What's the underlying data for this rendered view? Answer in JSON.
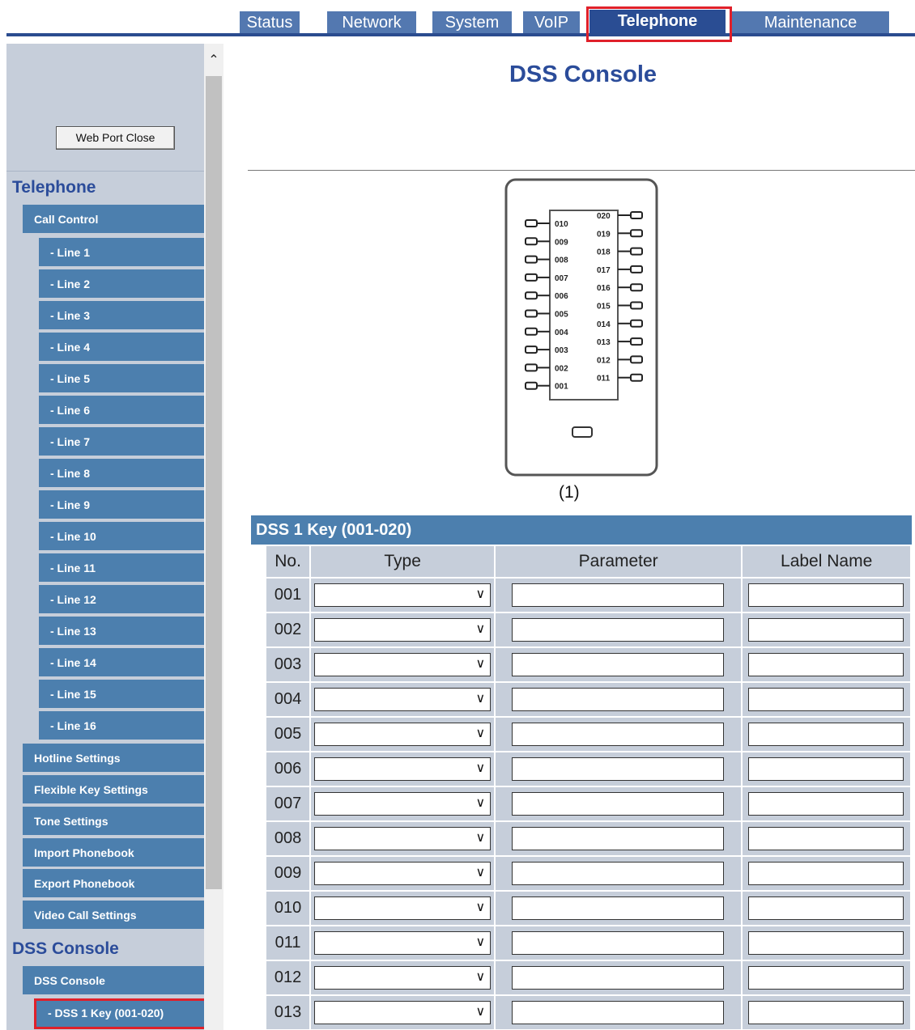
{
  "tabs": [
    {
      "label": "Status"
    },
    {
      "label": "Network"
    },
    {
      "label": "System"
    },
    {
      "label": "VoIP"
    },
    {
      "label": "Telephone"
    },
    {
      "label": "Maintenance"
    }
  ],
  "sidebar": {
    "web_port_button": "Web Port Close",
    "telephone_title": "Telephone",
    "call_control": "Call Control",
    "lines": [
      "- Line 1",
      "- Line 2",
      "- Line 3",
      "- Line 4",
      "- Line 5",
      "- Line 6",
      "- Line 7",
      "- Line 8",
      "- Line 9",
      "- Line 10",
      "- Line 11",
      "- Line 12",
      "- Line 13",
      "- Line 14",
      "- Line 15",
      "- Line 16"
    ],
    "items": [
      "Hotline Settings",
      "Flexible Key Settings",
      "Tone Settings",
      "Import Phonebook",
      "Export Phonebook",
      "Video Call Settings"
    ],
    "dss_title": "DSS Console",
    "dss_console": "DSS Console",
    "dss_key": "- DSS 1 Key (001-020)"
  },
  "main": {
    "title": "DSS Console",
    "console_caption": "(1)",
    "console_left_keys": [
      "010",
      "009",
      "008",
      "007",
      "006",
      "005",
      "004",
      "003",
      "002",
      "001"
    ],
    "console_right_keys": [
      "020",
      "019",
      "018",
      "017",
      "016",
      "015",
      "014",
      "013",
      "012",
      "011"
    ],
    "section_header": "DSS 1 Key (001-020)",
    "columns": [
      "No.",
      "Type",
      "Parameter",
      "Label Name"
    ],
    "rows": [
      "001",
      "002",
      "003",
      "004",
      "005",
      "006",
      "007",
      "008",
      "009",
      "010",
      "011",
      "012",
      "013"
    ]
  },
  "colors": {
    "tab": "#5378b0",
    "tab_active": "#2a4d93",
    "nav": "#4c7fae",
    "sidebar_bg": "#c6ceda",
    "title": "#2b4c9a",
    "highlight": "#e0202a"
  }
}
